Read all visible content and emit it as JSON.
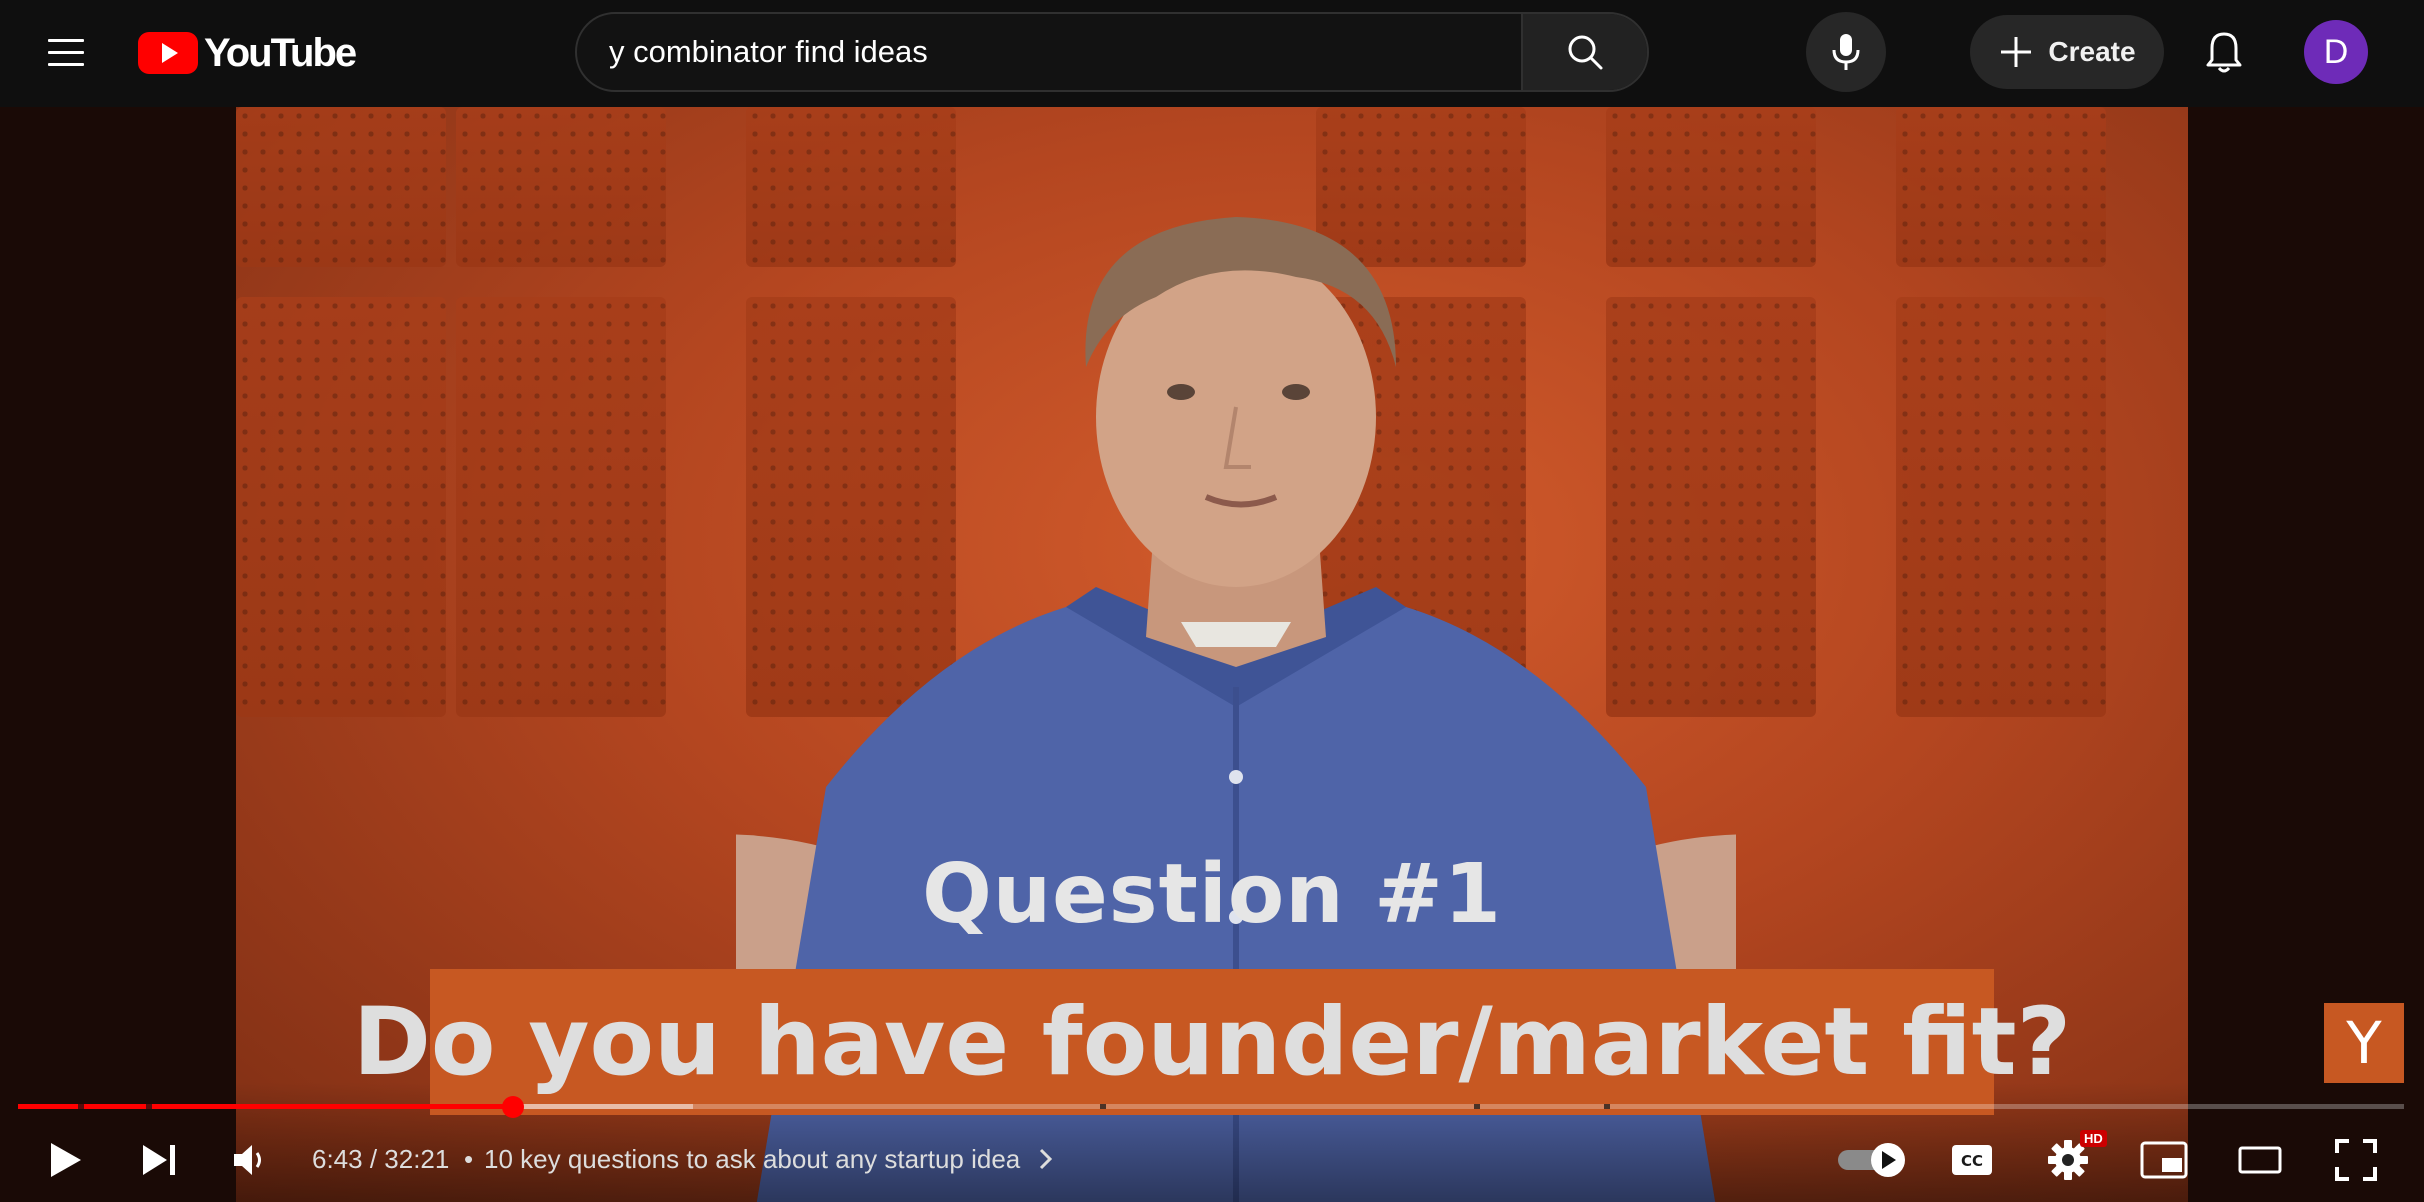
{
  "header": {
    "logo_text": "YouTube",
    "search_value": "y combinator find ideas",
    "create_label": "Create",
    "avatar_letter": "D"
  },
  "video": {
    "question_title": "Question #1",
    "question_text": "Do you have founder/market fit?",
    "channel_badge": "Y",
    "brand_color": "#c75822"
  },
  "player": {
    "time_display": "6:43 / 32:21",
    "separator": "•",
    "chapter_title": "10 key questions to ask about any startup idea",
    "hd_badge": "HD",
    "progress_played_fraction": 0.2075,
    "progress_buffered_fraction": 0.283,
    "accent_color": "#ff0000"
  }
}
